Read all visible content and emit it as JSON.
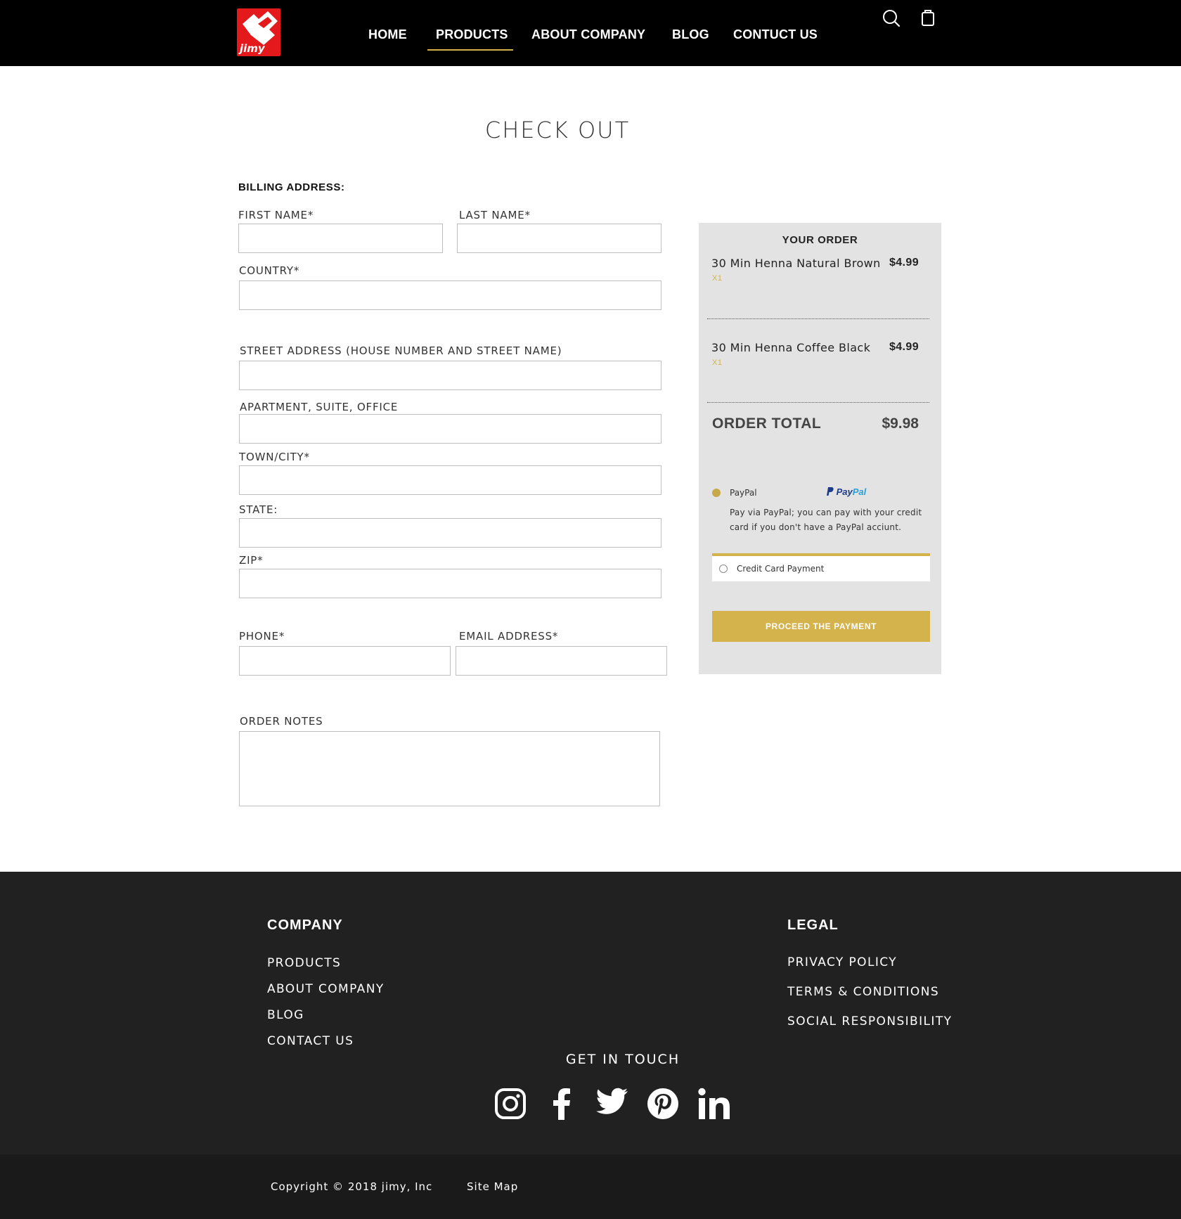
{
  "header": {
    "logo_text": "jimy",
    "nav": [
      {
        "label": "HOME"
      },
      {
        "label": "PRODUCTS"
      },
      {
        "label": "ABOUT COMPANY"
      },
      {
        "label": "BLOG"
      },
      {
        "label": "CONTUCT US"
      }
    ],
    "active_nav": "PRODUCTS",
    "icons": [
      "search-icon",
      "shopping-bag-icon"
    ]
  },
  "page_title": "CHECK OUT",
  "billing": {
    "title": "BILLING ADDRESS:",
    "first_name": {
      "label": "FIRST NAME*",
      "value": ""
    },
    "last_name": {
      "label": "LAST NAME*",
      "value": ""
    },
    "country": {
      "label": "COUNTRY*",
      "value": ""
    },
    "street": {
      "label": "STREET ADDRESS (HOUSE NUMBER AND STREET NAME)",
      "value": ""
    },
    "apartment": {
      "label": "APARTMENT, SUITE, OFFICE",
      "value": ""
    },
    "town": {
      "label": "TOWN/CITY*",
      "value": ""
    },
    "state": {
      "label": "STATE:",
      "value": ""
    },
    "zip": {
      "label": "ZIP*",
      "value": ""
    },
    "phone": {
      "label": "PHONE*",
      "value": ""
    },
    "email": {
      "label": "EMAIL ADDRESS*",
      "value": ""
    },
    "notes": {
      "label": "ORDER NOTES",
      "value": ""
    }
  },
  "order": {
    "title": "YOUR ORDER",
    "items": [
      {
        "name": "30 Min Henna Natural Brown",
        "price": "$4.99",
        "qty": "X1"
      },
      {
        "name": "30 Min Henna Coffee Black",
        "price": "$4.99",
        "qty": "X1"
      }
    ],
    "total_label": "ORDER TOTAL",
    "total_value": "$9.98",
    "paypal": {
      "label": "PayPal",
      "logo_text_a": "Pay",
      "logo_text_b": "Pal",
      "description": "Pay via PayPal; you can pay with your credit card if you don't have a PayPal acciunt.",
      "selected": true
    },
    "credit_card": {
      "label": "Credit Card Payment",
      "selected": false
    },
    "proceed_label": "PROCEED THE PAYMENT"
  },
  "footer": {
    "company_title": "COMPANY",
    "company_links": [
      "PRODUCTS",
      "ABOUT COMPANY",
      "BLOG",
      "CONTACT US"
    ],
    "legal_title": "LEGAL",
    "legal_links": [
      "PRIVACY POLICY",
      "TERMS & CONDITIONS",
      "SOCIAL RESPONSIBILITY"
    ],
    "get_in_touch": "GET IN TOUCH",
    "social_icons": [
      "instagram-icon",
      "facebook-icon",
      "twitter-icon",
      "pinterest-icon",
      "linkedin-icon"
    ],
    "copyright": "Copyright © 2018 jimy, Inc",
    "site_map": "Site Map"
  },
  "colors": {
    "accent": "#d4b24c",
    "brand_red": "#e3191c",
    "header_bg": "#000000",
    "footer_bg": "#212121",
    "panel_bg": "#e3e3e3"
  }
}
